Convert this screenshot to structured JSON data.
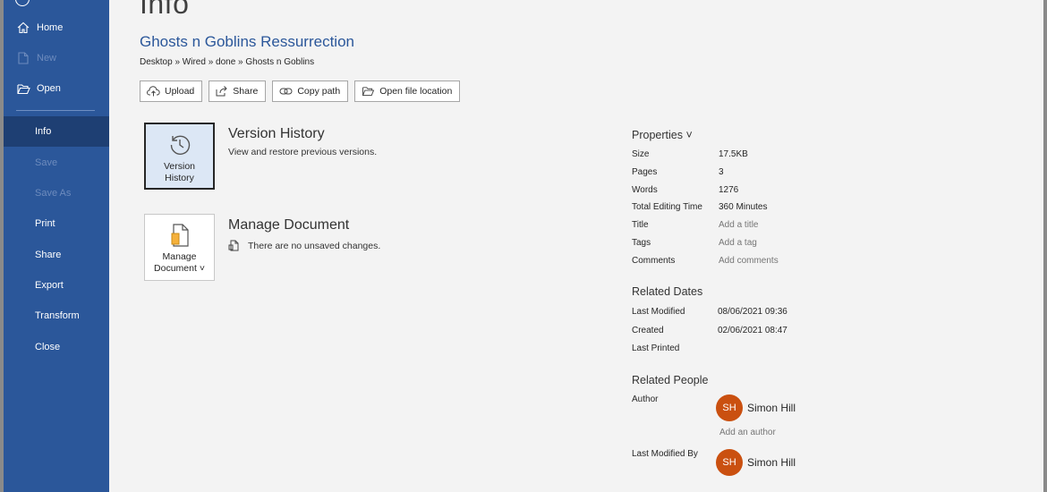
{
  "sidebar": {
    "items": [
      {
        "label": "Home",
        "icon": "home-icon"
      },
      {
        "label": "New",
        "icon": "new-document-icon"
      },
      {
        "label": "Open",
        "icon": "folder-open-icon"
      },
      {
        "label": "Info"
      },
      {
        "label": "Save"
      },
      {
        "label": "Save As"
      },
      {
        "label": "Print"
      },
      {
        "label": "Share"
      },
      {
        "label": "Export"
      },
      {
        "label": "Transform"
      },
      {
        "label": "Close"
      }
    ],
    "active_item": "Info",
    "disabled_items": [
      "New",
      "Save",
      "Save As"
    ]
  },
  "main": {
    "page_title": "Info",
    "doc_title": "Ghosts n Goblins Ressurrection",
    "breadcrumb": "Desktop » Wired » done » Ghosts n Goblins",
    "buttons": {
      "upload": "Upload",
      "share": "Share",
      "copy_path": "Copy path",
      "open_location": "Open file location"
    },
    "version_history": {
      "tile_label": "Version History",
      "heading": "Version History",
      "description": "View and restore previous versions."
    },
    "manage_document": {
      "tile_label": "Manage Document ˅",
      "heading": "Manage Document",
      "status": "There are no unsaved changes."
    }
  },
  "properties": {
    "heading": "Properties ˅",
    "rows": [
      {
        "key": "Size",
        "value": "17.5KB"
      },
      {
        "key": "Pages",
        "value": "3"
      },
      {
        "key": "Words",
        "value": "1276"
      },
      {
        "key": "Total Editing Time",
        "value": "360 Minutes"
      },
      {
        "key": "Title",
        "value": "Add a title"
      },
      {
        "key": "Tags",
        "value": "Add a tag"
      },
      {
        "key": "Comments",
        "value": "Add comments"
      }
    ],
    "dates_heading": "Related Dates",
    "dates": [
      {
        "key": "Last Modified",
        "value": "08/06/2021 09:36"
      },
      {
        "key": "Created",
        "value": "02/06/2021 08:47"
      },
      {
        "key": "Last Printed",
        "value": ""
      }
    ],
    "people_heading": "Related People",
    "author_label": "Author",
    "author": {
      "initials": "SH",
      "name": "Simon Hill"
    },
    "add_author": "Add an author",
    "last_modified_by_label": "Last Modified By",
    "last_modified_by": {
      "initials": "SH",
      "name": "Simon Hill"
    }
  },
  "colors": {
    "sidebar_bg": "#2b579a",
    "sidebar_active": "#1e3f73",
    "accent_text": "#2b579a",
    "avatar": "#ca5010"
  }
}
